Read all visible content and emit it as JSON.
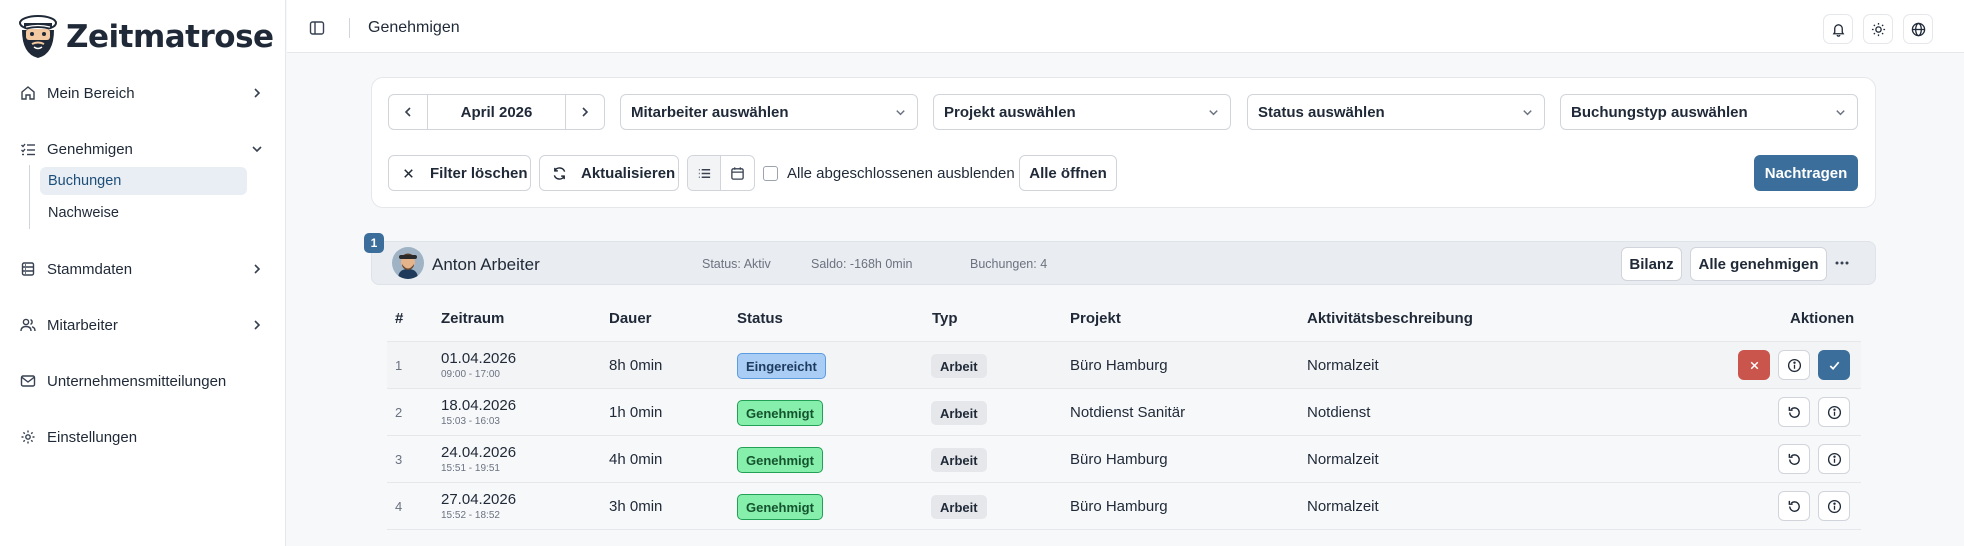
{
  "app": {
    "name": "Zeitmatrose"
  },
  "sidebar": {
    "items": [
      {
        "label": "Mein Bereich",
        "icon": "home-icon"
      },
      {
        "label": "Genehmigen",
        "icon": "list-check-icon",
        "expanded": true,
        "children": [
          {
            "label": "Buchungen",
            "active": true
          },
          {
            "label": "Nachweise"
          }
        ]
      },
      {
        "label": "Stammdaten",
        "icon": "database-icon"
      },
      {
        "label": "Mitarbeiter",
        "icon": "users-icon"
      },
      {
        "label": "Unternehmensmitteilungen",
        "icon": "mail-icon"
      },
      {
        "label": "Einstellungen",
        "icon": "gear-icon"
      }
    ]
  },
  "header": {
    "title": "Genehmigen",
    "icons": [
      "sidebar-toggle-icon",
      "bell-icon",
      "sun-icon",
      "globe-icon"
    ]
  },
  "filters": {
    "month": "April 2026",
    "employee_select": "Mitarbeiter auswählen",
    "project_select": "Projekt auswählen",
    "status_select": "Status auswählen",
    "booking_type_select": "Buchungstyp auswählen",
    "clear_label": "Filter löschen",
    "refresh_label": "Aktualisieren",
    "hide_completed_label": "Alle abgeschlossenen ausblenden",
    "hide_completed_checked": false,
    "open_all_label": "Alle öffnen",
    "add_label": "Nachtragen"
  },
  "employee": {
    "count_badge": "1",
    "name": "Anton Arbeiter",
    "status": "Status: Aktiv",
    "balance": "Saldo: -168h 0min",
    "bookings": "Buchungen: 4",
    "balance_button": "Bilanz",
    "approve_all_button": "Alle genehmigen"
  },
  "table": {
    "columns": [
      "#",
      "Zeitraum",
      "Dauer",
      "Status",
      "Typ",
      "Projekt",
      "Aktivitätsbeschreibung",
      "Aktionen"
    ],
    "rows": [
      {
        "idx": "1",
        "date": "01.04.2026",
        "time": "09:00 - 17:00",
        "duration": "8h 0min",
        "status": "Eingereicht",
        "type": "Arbeit",
        "project": "Büro Hamburg",
        "description": "Normalzeit"
      },
      {
        "idx": "2",
        "date": "18.04.2026",
        "time": "15:03 - 16:03",
        "duration": "1h 0min",
        "status": "Genehmigt",
        "type": "Arbeit",
        "project": "Notdienst Sanitär",
        "description": "Notdienst"
      },
      {
        "idx": "3",
        "date": "24.04.2026",
        "time": "15:51 - 19:51",
        "duration": "4h 0min",
        "status": "Genehmigt",
        "type": "Arbeit",
        "project": "Büro Hamburg",
        "description": "Normalzeit"
      },
      {
        "idx": "4",
        "date": "27.04.2026",
        "time": "15:52 - 18:52",
        "duration": "3h 0min",
        "status": "Genehmigt",
        "type": "Arbeit",
        "project": "Büro Hamburg",
        "description": "Normalzeit"
      }
    ]
  },
  "colors": {
    "primary": "#3b6e9a",
    "submitted": "#a9cdf5",
    "approved": "#86efac",
    "reject": "#c9554c"
  }
}
